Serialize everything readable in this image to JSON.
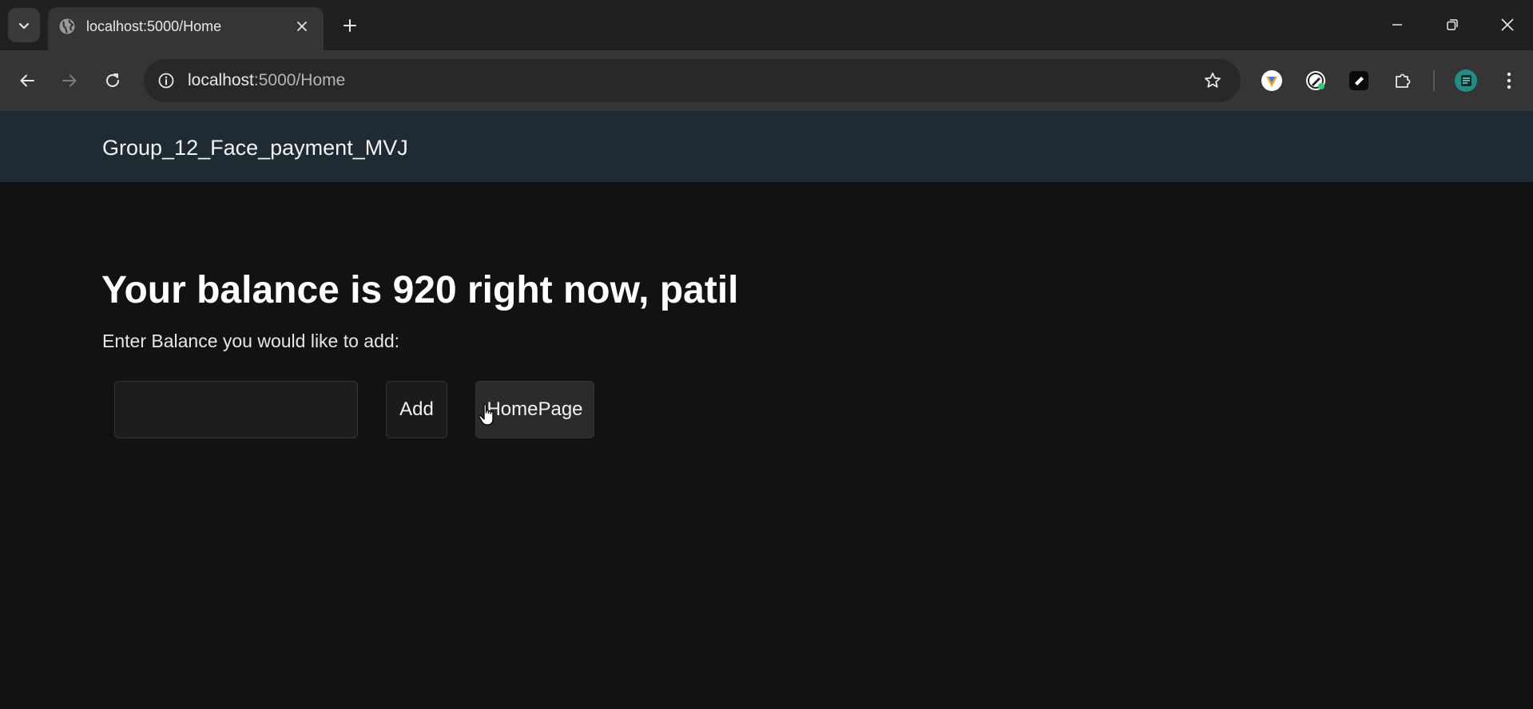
{
  "browser": {
    "tab_title": "localhost:5000/Home",
    "url_host": "localhost",
    "url_path": ":5000/Home",
    "icons": {
      "tab_search": "chevron-down-icon",
      "favicon": "globe-icon",
      "close_tab": "close-icon",
      "new_tab": "plus-icon",
      "back": "arrow-left-icon",
      "forward": "arrow-right-icon",
      "reload": "reload-icon",
      "site_info": "info-icon",
      "bookmark": "star-icon",
      "extensions": [
        "vpn-extension-icon",
        "edit-extension-icon",
        "dark-extension-icon",
        "puzzle-icon"
      ],
      "profile": "avatar",
      "menu": "kebab-menu-icon"
    }
  },
  "page": {
    "brand": "Group_12_Face_payment_MVJ",
    "heading": "Your balance is 920 right now, patil",
    "prompt": "Enter Balance you would like to add:",
    "amount_input_value": "",
    "add_button": "Add",
    "home_button": "HomePage"
  },
  "colors": {
    "navbar_bg": "#1f2b33",
    "page_bg": "#121212",
    "text": "#ffffff"
  }
}
